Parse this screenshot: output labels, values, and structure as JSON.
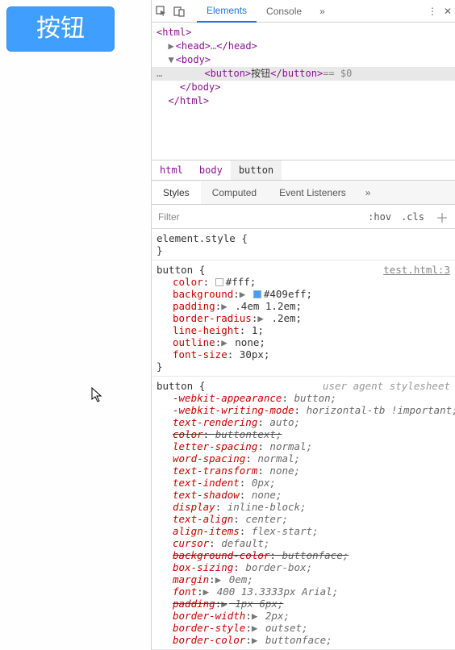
{
  "demo": {
    "button_label": "按钮"
  },
  "toolbar": {
    "tabs": {
      "elements": "Elements",
      "console": "Console"
    }
  },
  "dom": {
    "l0": "<html>",
    "l1_open": "<head>",
    "l1_mid": "…",
    "l1_close": "</head>",
    "l2": "<body>",
    "sel_open": "<button>",
    "sel_text": "按钮",
    "sel_close": "</button>",
    "sel_eq": " == $0",
    "l4": "</body>",
    "l5": "</html>"
  },
  "breadcrumb": {
    "a": "html",
    "b": "body",
    "c": "button"
  },
  "style_tabs": {
    "styles": "Styles",
    "computed": "Computed",
    "events": "Event Listeners"
  },
  "filter": {
    "placeholder": "Filter",
    "hov": ":hov",
    "cls": ".cls"
  },
  "rule_el": {
    "selector": "element.style",
    "open": "{",
    "close": "}"
  },
  "rule_btn": {
    "selector": "button",
    "open": "{",
    "close": "}",
    "source": "test.html:3",
    "d": {
      "color_p": "color",
      "color_v": "#fff;",
      "bg_p": "background",
      "bg_v": "#409eff;",
      "pad_p": "padding",
      "pad_v": ".4em 1.2em;",
      "br_p": "border-radius",
      "br_v": ".2em;",
      "lh_p": "line-height",
      "lh_v": "1;",
      "ol_p": "outline",
      "ol_v": "none;",
      "fs_p": "font-size",
      "fs_v": "30px;"
    }
  },
  "rule_ua": {
    "selector": "button",
    "open": "{",
    "label": "user agent stylesheet",
    "d": {
      "a1p": "-webkit-appearance",
      "a1v": "button;",
      "a2p": "-webkit-writing-mode",
      "a2v": "horizontal-tb !important;",
      "a3p": "text-rendering",
      "a3v": "auto;",
      "a4p": "color",
      "a4v": "buttontext;",
      "a5p": "letter-spacing",
      "a5v": "normal;",
      "a6p": "word-spacing",
      "a6v": "normal;",
      "a7p": "text-transform",
      "a7v": "none;",
      "a8p": "text-indent",
      "a8v": "0px;",
      "a9p": "text-shadow",
      "a9v": "none;",
      "a10p": "display",
      "a10v": "inline-block;",
      "a11p": "text-align",
      "a11v": "center;",
      "a12p": "align-items",
      "a12v": "flex-start;",
      "a13p": "cursor",
      "a13v": "default;",
      "a14p": "background-color",
      "a14v": "buttonface;",
      "a15p": "box-sizing",
      "a15v": "border-box;",
      "a16p": "margin",
      "a16v": "0em;",
      "a17p": "font",
      "a17v": "400 13.3333px Arial;",
      "a18p": "padding",
      "a18v": "1px 6px;",
      "a19p": "border-width",
      "a19v": "2px;",
      "a20p": "border-style",
      "a20v": "outset;",
      "a21p": "border-color",
      "a21v": "buttonface;"
    }
  },
  "glyph": {
    "triangle": "▶",
    "triangle_down": "▼",
    "dots": "…",
    "chev": "»",
    "vdots": "⋮",
    "close": "✕",
    "plus": "＋"
  }
}
